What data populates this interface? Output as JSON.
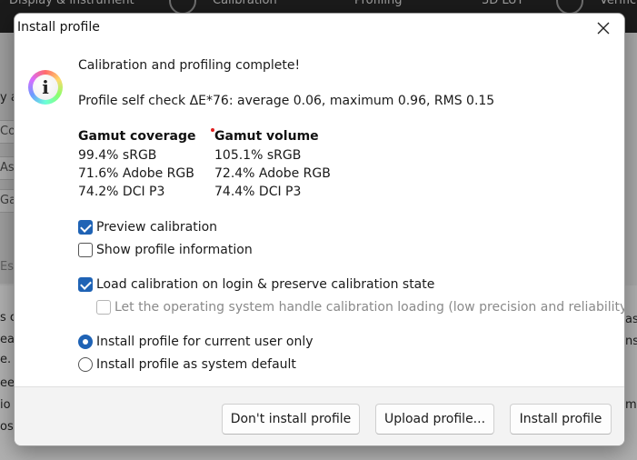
{
  "background": {
    "tabs": [
      "Display & instrument",
      "Calibration",
      "Profiling",
      "3D LUT",
      "Verification"
    ],
    "left_fields": [
      "Co",
      "As",
      "Ga",
      "Esti"
    ],
    "left_label": "y a",
    "content_lines": [
      "s c",
      "ea",
      "e. N",
      "ee",
      "io",
      "os"
    ],
    "content_lines_right": [
      "as",
      "ns",
      "m"
    ]
  },
  "dialog": {
    "title": "Install profile",
    "close_icon": "close-icon",
    "message": "Calibration and profiling complete!",
    "self_check": "Profile self check ΔE*76: average 0.06, maximum 0.96, RMS 0.15",
    "gamut_coverage": {
      "heading": "Gamut coverage",
      "rows": [
        "99.4% sRGB",
        "71.6% Adobe RGB",
        "74.2% DCI P3"
      ]
    },
    "gamut_volume": {
      "heading": "Gamut volume",
      "rows": [
        "105.1% sRGB",
        "72.4% Adobe RGB",
        "74.4% DCI P3"
      ]
    },
    "options": {
      "preview_calibration": {
        "label": "Preview calibration",
        "checked": true
      },
      "show_profile_info": {
        "label": "Show profile information",
        "checked": false
      },
      "load_calibration": {
        "label": "Load calibration on login & preserve calibration state",
        "checked": true
      },
      "os_handle_loading": {
        "label": "Let the operating system handle calibration loading (low precision and reliability)",
        "checked": false,
        "disabled": true
      }
    },
    "install_scope": {
      "current_user": {
        "label": "Install profile for current user only",
        "selected": true
      },
      "system_default": {
        "label": "Install profile as system default",
        "selected": false
      }
    },
    "buttons": {
      "dont_install": "Don't install profile",
      "upload": "Upload profile...",
      "install": "Install profile"
    },
    "accent_color": "#1f63b5"
  }
}
